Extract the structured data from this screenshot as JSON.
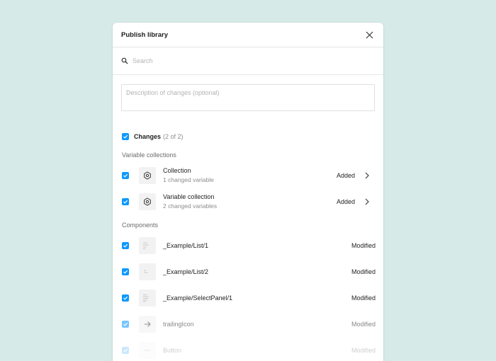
{
  "dialog": {
    "title": "Publish library",
    "close_icon": "close-icon"
  },
  "search": {
    "icon": "search-icon",
    "placeholder": "Search",
    "value": ""
  },
  "description": {
    "placeholder": "Description of changes (optional)",
    "value": ""
  },
  "changes": {
    "label": "Changes",
    "count": "(2 of 2)",
    "checked": true
  },
  "variable_collections": {
    "title": "Variable collections",
    "items": [
      {
        "name": "Collection",
        "subtitle": "1 changed variable",
        "status": "Added",
        "icon": "variable-collection-icon"
      },
      {
        "name": "Variable collection",
        "subtitle": "2 changed variables",
        "status": "Added",
        "icon": "variable-collection-icon"
      }
    ]
  },
  "components": {
    "title": "Components",
    "items": [
      {
        "name": "_Example/List/1",
        "status": "Modified",
        "icon": "list-preview-icon"
      },
      {
        "name": "_Example/List/2",
        "status": "Modified",
        "icon": "list-preview-icon"
      },
      {
        "name": "_Example/SelectPanel/1",
        "status": "Modified",
        "icon": "select-panel-preview-icon"
      },
      {
        "name": "trailingIcon",
        "status": "Modified",
        "icon": "arrow-right-icon"
      },
      {
        "name": "Button",
        "status": "Modified",
        "icon": "button-preview-icon"
      }
    ]
  },
  "colors": {
    "accent": "#0d99ff",
    "background": "#d6ebe8"
  }
}
